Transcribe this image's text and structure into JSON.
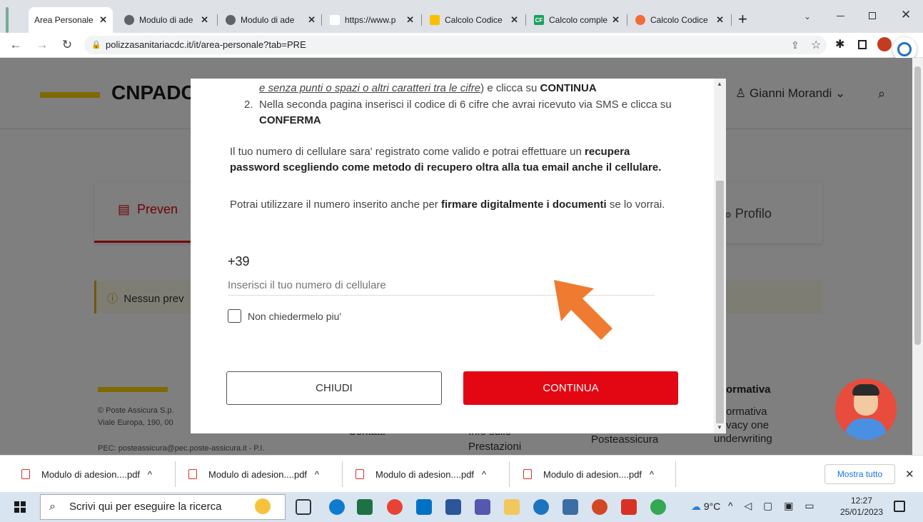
{
  "browser": {
    "tabs": [
      {
        "title": "Area Personale",
        "active": true
      },
      {
        "title": "Modulo di ade"
      },
      {
        "title": "Modulo di ade"
      },
      {
        "title": "https://www.p"
      },
      {
        "title": "Calcolo Codice"
      },
      {
        "title": "Calcolo comple"
      },
      {
        "title": "Calcolo Codice"
      }
    ],
    "url": "polizzasanitariacdc.it/it/area-personale?tab=PRE",
    "new_tab": "+"
  },
  "site": {
    "brand": "CNPADC",
    "user_name": "Gianni Morandi",
    "tab_prevenzione": "Preven",
    "tab_profilo": "Profilo",
    "notice": "Nessun prev",
    "footer_copyright": "© Poste Assicura S.p.",
    "footer_address": "Viale Europa, 190, 00",
    "footer_pec": "PEC: posteassicura@pec.poste-assicura.it - P.I.",
    "footer_contatti": "Contatti",
    "footer_info1": "Info sulle",
    "footer_info2": "Prestazioni",
    "footer_posteassicura": "Posteassicura",
    "footer_normativa_title": "ormativa",
    "footer_normativa": "ormativa",
    "footer_privacy": "vacy one",
    "footer_underwriting": "underwriting"
  },
  "modal": {
    "step1_link": "e senza punti o spazi o altri caratteri tra le cifre",
    "step1_mid": ") e clicca su ",
    "step1_bold": "CONTINUA",
    "step2_num": "2.",
    "step2_text": "Nella seconda pagina inserisci il codice di 6 cifre che avrai ricevuto via SMS e clicca su ",
    "step2_bold": "CONFERMA",
    "para1_a": "Il tuo numero di cellulare sara' registrato come valido e potrai effettuare un ",
    "para1_bold": "recupera password scegliendo come metodo di recupero oltra alla tua email anche il cellulare.",
    "para2_a": "Potrai utilizzare il numero inserito anche per ",
    "para2_bold": "firmare digitalmente i documenti",
    "para2_b": " se lo vorrai.",
    "prefix": "+39",
    "phone_placeholder": "Inserisci il tuo numero di cellulare",
    "checkbox_label": "Non chiedermelo piu'",
    "close_button": "CHIUDI",
    "continue_button": "CONTINUA"
  },
  "downloads": {
    "items": [
      "Modulo di adesion....pdf",
      "Modulo di adesion....pdf",
      "Modulo di adesion....pdf",
      "Modulo di adesion....pdf"
    ],
    "show_all": "Mostra tutto"
  },
  "taskbar": {
    "search_placeholder": "Scrivi qui per eseguire la ricerca",
    "weather": "9°C",
    "time": "12:27",
    "date": "25/01/2023"
  },
  "colors": {
    "accent_red": "#e30613",
    "arrow_orange": "#ee7b2f",
    "brand_yellow": "#ffd200"
  }
}
